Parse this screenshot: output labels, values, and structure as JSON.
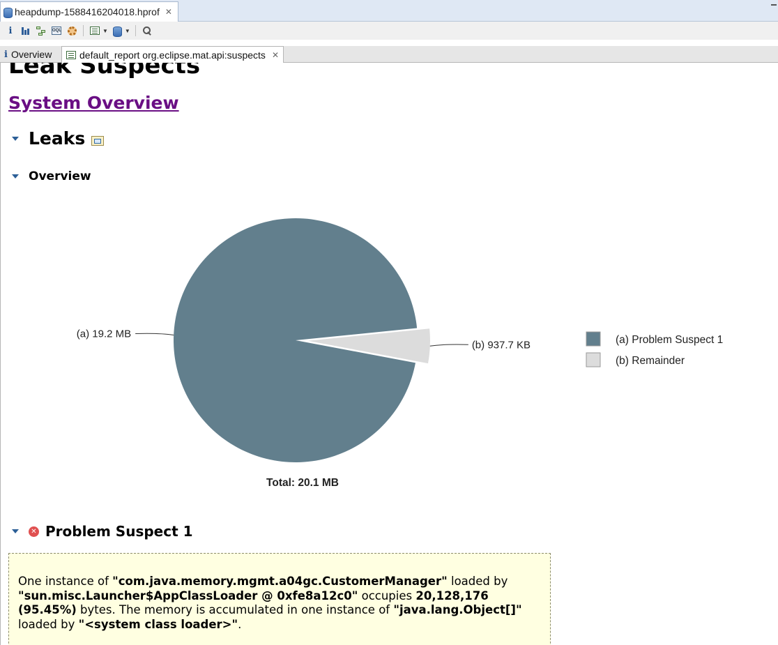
{
  "editor_tab": {
    "filename": "heapdump-1588416204018.hprof",
    "icon": "database-icon"
  },
  "toolbar": {
    "buttons": [
      "info-icon",
      "histogram-icon",
      "dominator-tree-icon",
      "oql-icon",
      "thread-overview-icon",
      "run-report-icon",
      "query-browser-icon",
      "search-icon"
    ]
  },
  "view_tabs": [
    {
      "label": "Overview",
      "icon": "info-icon"
    },
    {
      "label": "default_report  org.eclipse.mat.api:suspects",
      "icon": "report-icon"
    }
  ],
  "page": {
    "title": "Leak Suspects",
    "system_overview_link": "System Overview",
    "leaks_heading": "Leaks",
    "overview_heading": "Overview",
    "suspect_heading": "Problem Suspect 1"
  },
  "chart_data": {
    "type": "pie",
    "slices": [
      {
        "label": "(a)  19.2 MB",
        "value": 19.2,
        "unit": "MB",
        "color": "#627f8d",
        "legend": "(a)  Problem Suspect 1"
      },
      {
        "label": "(b)  937.7 KB",
        "value": 0.9157,
        "unit": "MB",
        "color": "#dcdcdc",
        "legend": "(b)  Remainder"
      }
    ],
    "total_label": "Total: 20.1 MB"
  },
  "suspect_message": {
    "p1": "One instance of ",
    "class_name": "\"com.java.memory.mgmt.a04gc.CustomerManager\"",
    "p2": " loaded by ",
    "loader": "\"sun.misc.Launcher$AppClassLoader @ 0xfe8a12c0\"",
    "p3": " occupies ",
    "bytes": "20,128,176",
    "percent": "(95.45%)",
    "p4": " bytes. The memory is accumulated in one instance of ",
    "object_type": "\"java.lang.Object[]\"",
    "p5": " loaded by ",
    "system_loader": "\"<system class loader>\"",
    "p6": "."
  },
  "colors": {
    "link": "#6a0f84",
    "pie_main": "#627f8d",
    "pie_rest": "#dcdcdc",
    "message_bg": "#ffffe1"
  }
}
